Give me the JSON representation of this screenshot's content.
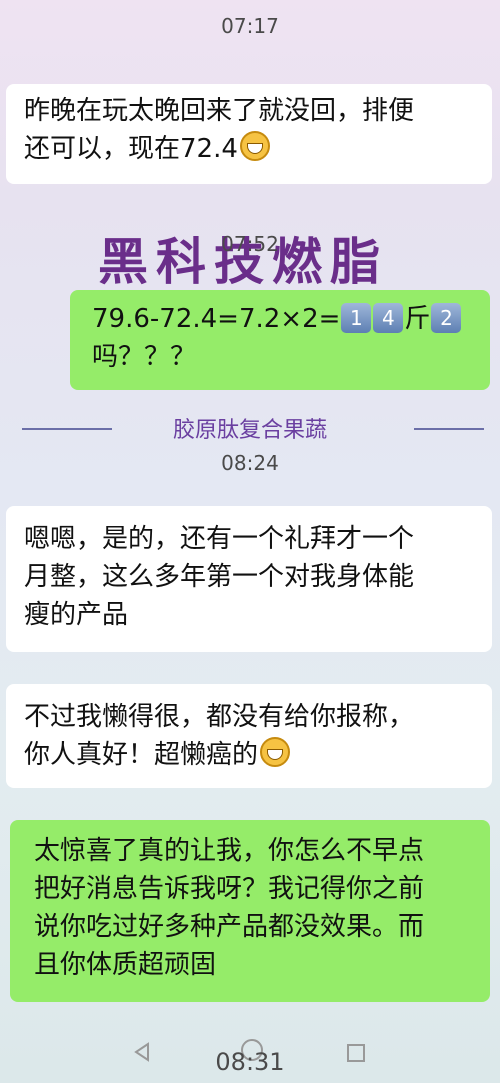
{
  "messages": [
    {
      "time": "07:17"
    },
    {
      "side": "left",
      "lines": [
        "昨晚在玩太晚回来了就没回，排便",
        "还可以，现在72.4"
      ]
    },
    {
      "time": "07:52"
    },
    {
      "side": "right",
      "line1": "79.6-72.4=7.2×2=",
      "keys": [
        "1",
        "4",
        "2"
      ],
      "unit": "斤",
      "line2": "吗？？？"
    },
    {
      "time": "08:24"
    },
    {
      "side": "left",
      "lines": [
        "嗯嗯，是的，还有一个礼拜才一个",
        "月整，这么多年第一个对我身体能",
        "瘦的产品"
      ]
    },
    {
      "side": "left",
      "lines": [
        "不过我懒得很，都没有给你报称，",
        "你人真好！超懒癌的"
      ]
    },
    {
      "side": "right",
      "lines": [
        "太惊喜了真的让我，你怎么不早点",
        "把好消息告诉我呀？我记得你之前",
        "说你吃过好多种产品都没效果。而",
        "且你体质超顽固"
      ]
    },
    {
      "time": "08:31"
    }
  ],
  "watermark": {
    "title": "黑科技燃脂",
    "caption": "胶原肽复合果蔬"
  },
  "icons": {
    "emoji": "grinning-face",
    "back": "triangle-back-icon",
    "recent": "square-recent-icon"
  },
  "colors": {
    "green_bubble": "#95ec69",
    "white_bubble": "#ffffff",
    "watermark": "#6a2e8a"
  }
}
